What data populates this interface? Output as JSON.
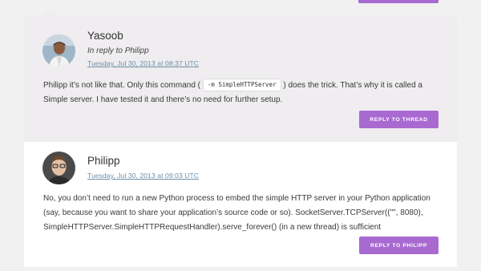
{
  "comments": [
    {
      "author": "Yasoob",
      "in_reply_to": "In reply to Philipp",
      "date": "Tuesday, Jul 30, 2013 at 08:37 UTC",
      "body_before": "Philipp it’s not like that. Only this command ( ",
      "code": "-m SimpleHTTPServer",
      "body_after": " ) does the trick. That’s why it is called a Simple server. I have tested it and there’s no need for further setup.",
      "reply_label": "REPLY TO THREAD"
    },
    {
      "author": "Philipp",
      "date": "Tuesday, Jul 30, 2013 at 09:03 UTC",
      "body": "No, you don’t need to run a new Python process to embed the simple HTTP server in your Python application (say, because you want to share your application’s source code or so). SocketServer.TCPServer((\"\", 8080), SimpleHTTPServer.SimpleHTTPRequestHandler).serve_forever() (in a new thread) is sufficient",
      "reply_label": "REPLY TO PHILIPP"
    }
  ],
  "colors": {
    "button": "#a86ad0",
    "reply_background": "#efedef",
    "link": "#6d8fa8"
  }
}
